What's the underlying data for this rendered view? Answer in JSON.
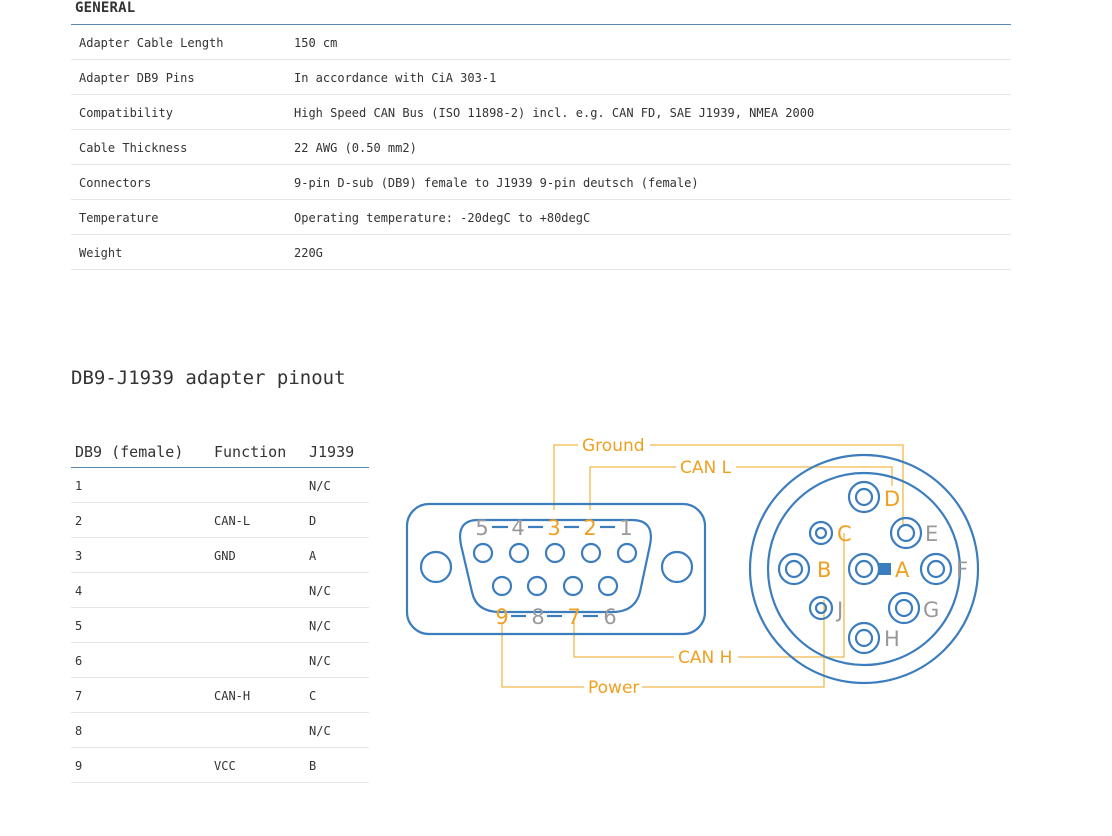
{
  "general": {
    "title": "GENERAL",
    "rows": [
      {
        "key": "Adapter Cable Length",
        "value": "150 cm"
      },
      {
        "key": "Adapter DB9 Pins",
        "value": "In accordance with CiA 303-1"
      },
      {
        "key": "Compatibility",
        "value": "High Speed CAN Bus (ISO 11898-2) incl. e.g. CAN FD, SAE J1939, NMEA 2000"
      },
      {
        "key": "Cable Thickness",
        "value": "22 AWG (0.50 mm2)"
      },
      {
        "key": "Connectors",
        "value": "9-pin D-sub (DB9) female to J1939 9-pin deutsch (female)"
      },
      {
        "key": "Temperature",
        "value": "Operating temperature: -20degC to +80degC"
      },
      {
        "key": "Weight",
        "value": "220G"
      }
    ]
  },
  "pinout": {
    "title": "DB9-J1939 adapter pinout",
    "headers": [
      "DB9 (female)",
      "Function",
      "J1939"
    ],
    "rows": [
      {
        "db9": "1",
        "function": "",
        "j1939": "N/C"
      },
      {
        "db9": "2",
        "function": "CAN-L",
        "j1939": "D"
      },
      {
        "db9": "3",
        "function": "GND",
        "j1939": "A"
      },
      {
        "db9": "4",
        "function": "",
        "j1939": "N/C"
      },
      {
        "db9": "5",
        "function": "",
        "j1939": "N/C"
      },
      {
        "db9": "6",
        "function": "",
        "j1939": "N/C"
      },
      {
        "db9": "7",
        "function": "CAN-H",
        "j1939": "C"
      },
      {
        "db9": "8",
        "function": "",
        "j1939": "N/C"
      },
      {
        "db9": "9",
        "function": "VCC",
        "j1939": "B"
      }
    ]
  },
  "diagram": {
    "labels": {
      "ground": "Ground",
      "can_l": "CAN L",
      "can_h": "CAN H",
      "power": "Power"
    },
    "db9_top_numbers": [
      "5",
      "4",
      "3",
      "2",
      "1"
    ],
    "db9_bottom_numbers": [
      "9",
      "8",
      "7",
      "6"
    ],
    "j1939_letters": {
      "A": "A",
      "B": "B",
      "C": "C",
      "D": "D",
      "E": "E",
      "F": "F",
      "G": "G",
      "H": "H",
      "J": "J"
    },
    "colors": {
      "connector": "#3c7dbd",
      "active": "#f0a020",
      "inactive": "#999999",
      "wire": "#f0b84a"
    }
  }
}
